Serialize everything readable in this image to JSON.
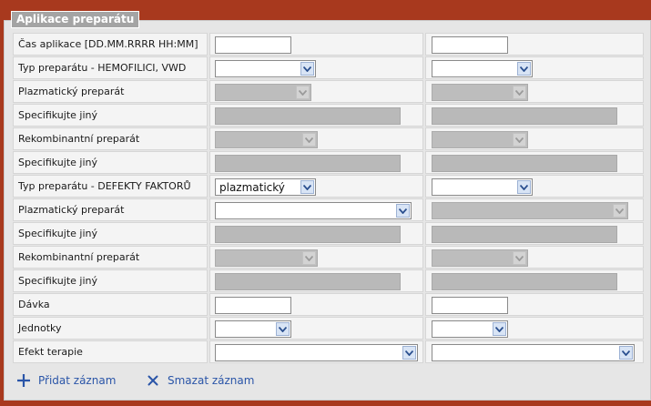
{
  "panel": {
    "title": "Aplikace preparátu"
  },
  "rows": [
    {
      "label": "Čas aplikace [DD.MM.RRRR HH:MM]",
      "c1": {
        "value": ""
      },
      "c2": {
        "value": ""
      }
    },
    {
      "label": "Typ preparátu - HEMOFILICI, VWD",
      "c1": {
        "value": ""
      },
      "c2": {
        "value": ""
      }
    },
    {
      "label": "Plazmatický preparát",
      "c1": {
        "value": ""
      },
      "c2": {
        "value": ""
      }
    },
    {
      "label": "Specifikujte jiný",
      "c1": {
        "value": ""
      },
      "c2": {
        "value": ""
      }
    },
    {
      "label": "Rekombinantní preparát",
      "c1": {
        "value": ""
      },
      "c2": {
        "value": ""
      }
    },
    {
      "label": "Specifikujte jiný",
      "c1": {
        "value": ""
      },
      "c2": {
        "value": ""
      }
    },
    {
      "label": "Typ preparátu - DEFEKTY FAKTORŮ",
      "c1": {
        "value": "plazmatický"
      },
      "c2": {
        "value": ""
      }
    },
    {
      "label": "Plazmatický preparát",
      "c1": {
        "value": ""
      },
      "c2": {
        "value": ""
      }
    },
    {
      "label": "Specifikujte jiný",
      "c1": {
        "value": ""
      },
      "c2": {
        "value": ""
      }
    },
    {
      "label": "Rekombinantní preparát",
      "c1": {
        "value": ""
      },
      "c2": {
        "value": ""
      }
    },
    {
      "label": "Specifikujte jiný",
      "c1": {
        "value": ""
      },
      "c2": {
        "value": ""
      }
    },
    {
      "label": "Dávka",
      "c1": {
        "value": ""
      },
      "c2": {
        "value": ""
      }
    },
    {
      "label": "Jednotky",
      "c1": {
        "value": ""
      },
      "c2": {
        "value": ""
      }
    },
    {
      "label": "Efekt terapie",
      "c1": {
        "value": ""
      },
      "c2": {
        "value": ""
      }
    }
  ],
  "actions": {
    "add_label": "Přidat záznam",
    "delete_label": "Smazat záznam"
  },
  "icons": {
    "add": "plus-icon",
    "delete": "close-icon",
    "dropdown": "chevron-down-icon"
  },
  "colors": {
    "frame": "#a8391e",
    "panel": "#e6e6e6",
    "link": "#2a55a8",
    "disabled": "#b9b9b9"
  }
}
